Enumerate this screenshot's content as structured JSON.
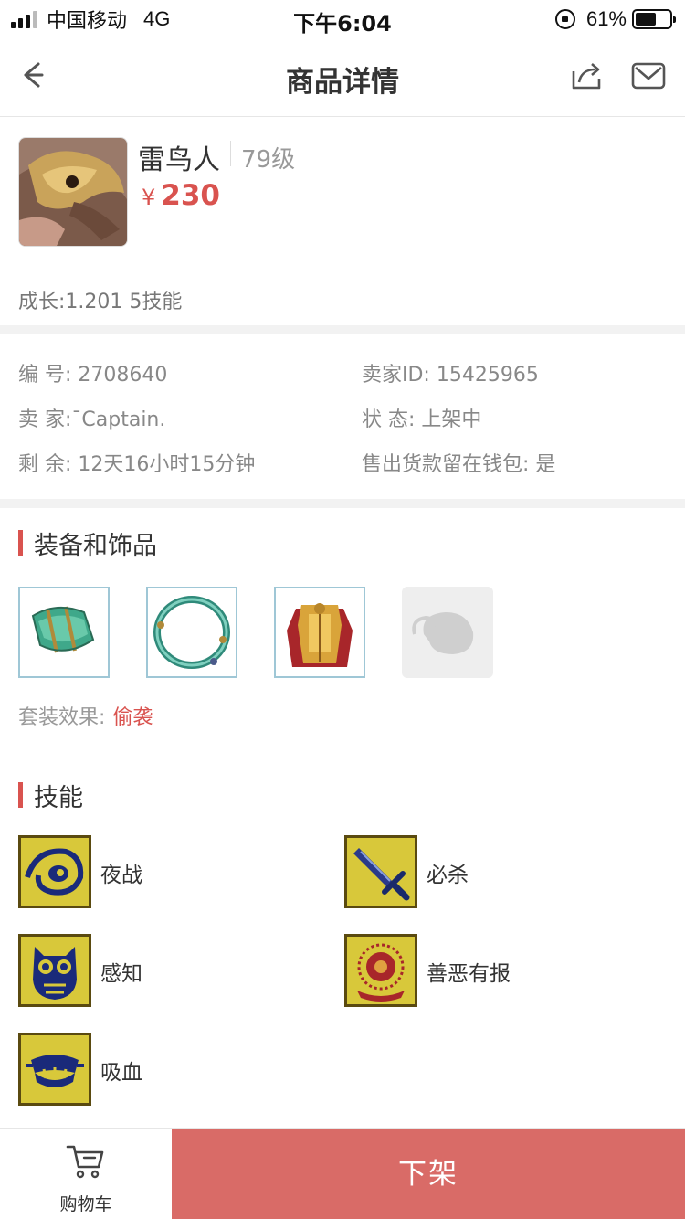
{
  "status_bar": {
    "carrier": "中国移动",
    "network": "4G",
    "time": "下午6:04",
    "battery_percent": "61%",
    "battery_level": 0.61
  },
  "nav": {
    "title": "商品详情",
    "back_icon": "back-arrow-icon",
    "share_icon": "share-icon",
    "mail_icon": "mail-icon"
  },
  "product": {
    "name": "雷鸟人",
    "level": "79级",
    "currency": "¥",
    "price": "230",
    "growth": "成长:1.201 5技能"
  },
  "info": {
    "row1": {
      "left": "编  号: 2708640",
      "right": "卖家ID: 15425965"
    },
    "row2": {
      "left": "卖  家:ˉCaptain.",
      "right": "状  态: 上架中"
    },
    "row3": {
      "left": "剩  余: 12天16小时15分钟",
      "right": "售出货款留在钱包: 是"
    }
  },
  "equipment": {
    "title": "装备和饰品",
    "items": [
      "bracer-icon",
      "ring-icon",
      "armor-icon",
      "empty-slot-icon"
    ],
    "set_label": "套装效果:",
    "set_value": "偷袭"
  },
  "skills": {
    "title": "技能",
    "items": [
      {
        "label": "夜战",
        "icon": "eye-skill-icon"
      },
      {
        "label": "必杀",
        "icon": "sword-skill-icon"
      },
      {
        "label": "感知",
        "icon": "owl-skill-icon"
      },
      {
        "label": "善恶有报",
        "icon": "orb-skill-icon"
      },
      {
        "label": "吸血",
        "icon": "fang-skill-icon"
      }
    ]
  },
  "bottom_bar": {
    "cart_label": "购物车",
    "action_label": "下架"
  },
  "colors": {
    "accent": "#d9534f",
    "action_button": "#d96b67",
    "divider_band": "#f2f2f2"
  }
}
